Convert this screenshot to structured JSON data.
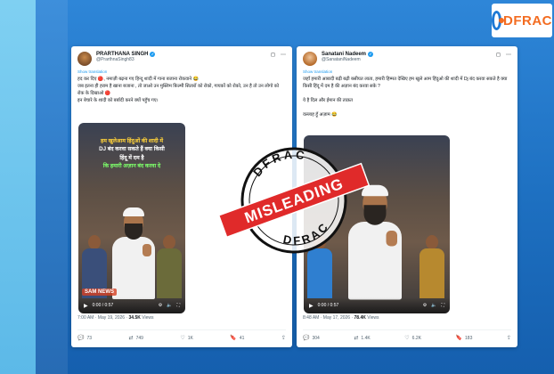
{
  "logo": {
    "text_main": "DFR",
    "text_accent": "AC"
  },
  "stamp": {
    "top_text": "DFRAC",
    "bottom_text": "DFRAC",
    "banner": "MISLEADING",
    "color": "#e02a2a"
  },
  "left_tweet": {
    "display_name": "PRARTHANA SINGH",
    "handle": "@PrarthnaSingh83",
    "translation_link": "Show translation",
    "text": "हद कर दिए 🔴, नमाज़ी बढ़ना गए हिन्दू शादी में गाना बजाना रोकवाने 😂\nजब इतना ही हराम है खाना बजाना , तो जाओ उन मुस्लिम फ़िल्मी सितारों को रोको, गायकों को रोको, उन है तो उन लोगो को रोक के दिखाओ 🔴\nइन बेचारे के शादी को बर्बादी करने क्यों पहुँच गए।",
    "video_overlay": {
      "line1": "हम खुलेआम हिंदुओं की शादी में",
      "line2": "DJ बंद करवा सकते हैं क्या किसी",
      "line3": "हिंदू में दम है",
      "line4": "कि हमारी अज़ान बंद करवा दे"
    },
    "video_time": "0:00 / 0:57",
    "watermark": "SAM NEWS",
    "meta_time": "7:00 AM · May 19, 2026 · ",
    "meta_views": "34.5K",
    "meta_views_label": " Views",
    "actions": {
      "replies": "73",
      "reposts": "749",
      "likes": "1K",
      "bookmarks": "41"
    }
  },
  "right_tweet": {
    "display_name": "Sanatani Nadeem",
    "handle": "@SanataniNadeem",
    "translation_link": "Show translation",
    "text": "जहाँ हमारी आबादी बढ़ी बढ़ी बसीयत लाता, हमारी हिम्मत देखिए हम खुले आम हिंदुओ की शादी में Dj बंद करवा सकते है क्या किसी हिंदू में दम है की अज़ान बंद करवा सके ?\n\nये है दिल और ईमान की ताक़त\n\nवल्लाह हूँ अज़ाम 😂",
    "video_time": "0:00 / 0:57",
    "meta_time": "8:48 AM · May 17, 2026 · ",
    "meta_views": "78.4K",
    "meta_views_label": " Views",
    "actions": {
      "replies": "304",
      "reposts": "1.4K",
      "likes": "6.2K",
      "bookmarks": "183"
    }
  }
}
